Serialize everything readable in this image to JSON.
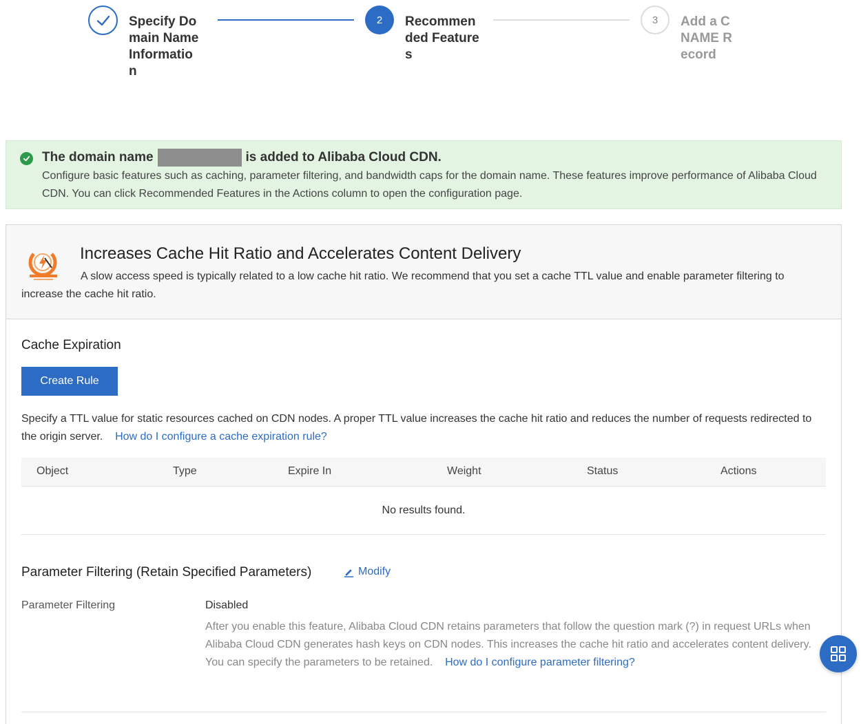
{
  "steps": [
    {
      "number": "",
      "label": "Specify Domain Name Informatio n",
      "state": "done"
    },
    {
      "number": "2",
      "label": "Recommen ded Features",
      "state": "active"
    },
    {
      "number": "3",
      "label": "Add a CNAME Record",
      "state": "pending"
    }
  ],
  "banner": {
    "title_prefix": "The domain name",
    "title_suffix": "is added to Alibaba Cloud CDN.",
    "description": "Configure basic features such as caching, parameter filtering, and bandwidth caps for the domain name. These features improve performance of Alibaba Cloud CDN. You can click Recommended Features in the Actions column to open the configuration page."
  },
  "panel": {
    "title": "Increases Cache Hit Ratio and Accelerates Content Delivery",
    "description": "A slow access speed is typically related to a low cache hit ratio. We recommend that you set a cache TTL value and enable parameter filtering to increase the cache hit ratio."
  },
  "cache": {
    "section_title": "Cache Expiration",
    "create_button": "Create Rule",
    "description": "Specify a TTL value for static resources cached on CDN nodes. A proper TTL value increases the cache hit ratio and reduces the number of requests redirected to the origin server.",
    "help_link": "How do I configure a cache expiration rule?",
    "columns": [
      "Object",
      "Type",
      "Expire In",
      "Weight",
      "Status",
      "Actions"
    ],
    "empty_text": "No results found."
  },
  "param_filter": {
    "section_title": "Parameter Filtering (Retain Specified Parameters)",
    "modify_label": "Modify",
    "label": "Parameter Filtering",
    "value": "Disabled",
    "description": "After you enable this feature, Alibaba Cloud CDN retains parameters that follow the question mark (?) in request URLs when Alibaba Cloud CDN generates hash keys on CDN nodes. This increases the cache hit ratio and accelerates content delivery. You can specify the parameters to be retained.",
    "help_link": "How do I configure parameter filtering?"
  },
  "colors": {
    "primary": "#2c6cc4",
    "success": "#2d9a49",
    "banner_bg": "#e3f4e3"
  },
  "icons": {
    "float_button": "grid-icon",
    "step_done": "check-icon",
    "banner": "success-check-icon",
    "panel": "cache-acceleration-icon",
    "modify": "edit-pencil-icon"
  }
}
